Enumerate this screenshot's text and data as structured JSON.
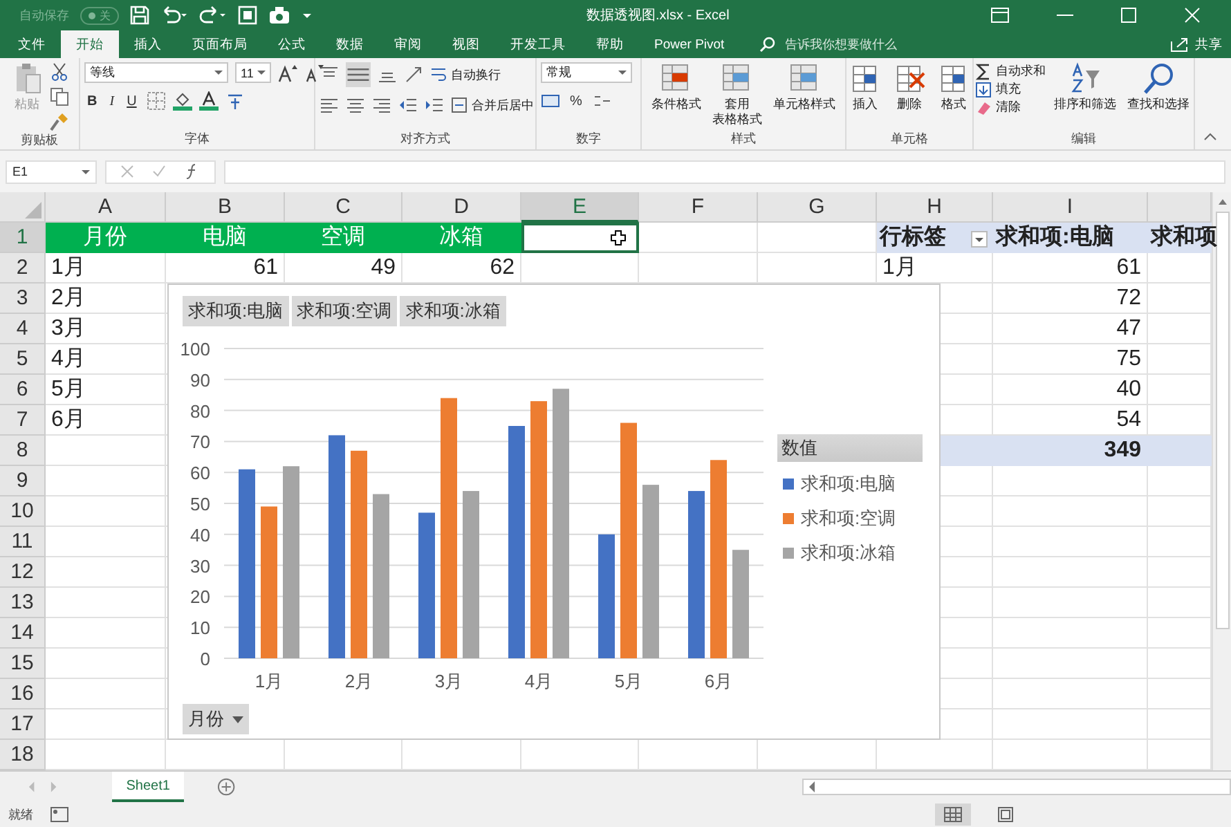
{
  "title_bar": {
    "autosave_label": "自动保存",
    "autosave_toggle": {
      "label": "关",
      "on": false
    },
    "title": "数据透视图.xlsx - Excel"
  },
  "tabs": [
    {
      "label": "文件",
      "selected": false
    },
    {
      "label": "开始",
      "selected": true
    },
    {
      "label": "插入",
      "selected": false
    },
    {
      "label": "页面布局",
      "selected": false
    },
    {
      "label": "公式",
      "selected": false
    },
    {
      "label": "数据",
      "selected": false
    },
    {
      "label": "审阅",
      "selected": false
    },
    {
      "label": "视图",
      "selected": false
    },
    {
      "label": "开发工具",
      "selected": false
    },
    {
      "label": "帮助",
      "selected": false
    },
    {
      "label": "Power Pivot",
      "selected": false
    }
  ],
  "tell_me": {
    "placeholder": "告诉我你想要做什么"
  },
  "share": "共享",
  "ribbon": {
    "clipboard": {
      "label": "剪贴板",
      "paste": "粘贴"
    },
    "font": {
      "label": "字体",
      "font_name": "等线",
      "font_size": "11",
      "bold": "B",
      "italic": "I",
      "underline": "U"
    },
    "alignment": {
      "label": "对齐方式",
      "wrap": "自动换行",
      "merge": "合并后居中"
    },
    "number": {
      "label": "数字",
      "format": "常规",
      "percent": "%"
    },
    "styles": {
      "label": "样式",
      "items": [
        {
          "lines": [
            "条件格式"
          ]
        },
        {
          "lines": [
            "套用",
            "表格格式"
          ]
        },
        {
          "lines": [
            "单元格样式"
          ]
        }
      ]
    },
    "cells": {
      "label": "单元格",
      "items": [
        {
          "label": "插入"
        },
        {
          "label": "删除"
        },
        {
          "label": "格式"
        }
      ]
    },
    "editing": {
      "label": "编辑",
      "autosum": "自动求和",
      "fill": "填充",
      "clear": "清除",
      "sort": "排序和筛选",
      "find": "查找和选择"
    }
  },
  "formula_bar": {
    "name_box": "E1"
  },
  "sheet": {
    "columns": [
      {
        "label": "A",
        "selected": false
      },
      {
        "label": "B",
        "selected": false
      },
      {
        "label": "C",
        "selected": false
      },
      {
        "label": "D",
        "selected": false
      },
      {
        "label": "E",
        "selected": true
      },
      {
        "label": "F",
        "selected": false
      },
      {
        "label": "G",
        "selected": false
      },
      {
        "label": "H",
        "selected": false
      },
      {
        "label": "I",
        "selected": false
      },
      {
        "selected": false
      }
    ],
    "rows": [
      {
        "number": "1",
        "selected": true,
        "cells": [
          {
            "kind": "header",
            "text": "月份"
          },
          {
            "kind": "header",
            "text": "电脑"
          },
          {
            "kind": "header",
            "text": "空调"
          },
          {
            "kind": "header",
            "text": "冰箱"
          },
          {
            "kind": "empty"
          },
          {
            "kind": "empty"
          },
          {
            "kind": "empty"
          },
          {
            "kind": "pivot_header",
            "text": "行标签",
            "filter": true
          },
          {
            "kind": "pivot_header",
            "text": "求和项:电脑"
          },
          {
            "kind": "pivot_header",
            "text": "求和项"
          }
        ]
      },
      {
        "number": "2",
        "selected": false,
        "cells": [
          {
            "kind": "text",
            "text": "1月"
          },
          {
            "kind": "number",
            "text": "61"
          },
          {
            "kind": "number",
            "text": "49"
          },
          {
            "kind": "number",
            "text": "62"
          },
          {
            "kind": "empty"
          },
          {
            "kind": "empty"
          },
          {
            "kind": "empty"
          },
          {
            "kind": "text",
            "text": "1月"
          },
          {
            "kind": "number",
            "text": "61"
          },
          {
            "kind": "empty"
          }
        ]
      },
      {
        "number": "3",
        "selected": false,
        "cells": [
          {
            "kind": "text",
            "text": "2月"
          },
          {
            "kind": "empty"
          },
          {
            "kind": "empty"
          },
          {
            "kind": "empty"
          },
          {
            "kind": "empty"
          },
          {
            "kind": "empty"
          },
          {
            "kind": "empty"
          },
          {
            "kind": "empty"
          },
          {
            "kind": "number",
            "text": "72"
          },
          {
            "kind": "empty"
          }
        ]
      },
      {
        "number": "4",
        "selected": false,
        "cells": [
          {
            "kind": "text",
            "text": "3月"
          },
          {
            "kind": "empty"
          },
          {
            "kind": "empty"
          },
          {
            "kind": "empty"
          },
          {
            "kind": "empty"
          },
          {
            "kind": "empty"
          },
          {
            "kind": "empty"
          },
          {
            "kind": "empty"
          },
          {
            "kind": "number",
            "text": "47"
          },
          {
            "kind": "empty"
          }
        ]
      },
      {
        "number": "5",
        "selected": false,
        "cells": [
          {
            "kind": "text",
            "text": "4月"
          },
          {
            "kind": "empty"
          },
          {
            "kind": "empty"
          },
          {
            "kind": "empty"
          },
          {
            "kind": "empty"
          },
          {
            "kind": "empty"
          },
          {
            "kind": "empty"
          },
          {
            "kind": "empty"
          },
          {
            "kind": "number",
            "text": "75"
          },
          {
            "kind": "empty"
          }
        ]
      },
      {
        "number": "6",
        "selected": false,
        "cells": [
          {
            "kind": "text",
            "text": "5月"
          },
          {
            "kind": "empty"
          },
          {
            "kind": "empty"
          },
          {
            "kind": "empty"
          },
          {
            "kind": "empty"
          },
          {
            "kind": "empty"
          },
          {
            "kind": "empty"
          },
          {
            "kind": "empty"
          },
          {
            "kind": "number",
            "text": "40"
          },
          {
            "kind": "empty"
          }
        ]
      },
      {
        "number": "7",
        "selected": false,
        "cells": [
          {
            "kind": "text",
            "text": "6月"
          },
          {
            "kind": "empty"
          },
          {
            "kind": "empty"
          },
          {
            "kind": "empty"
          },
          {
            "kind": "empty"
          },
          {
            "kind": "empty"
          },
          {
            "kind": "empty"
          },
          {
            "kind": "empty"
          },
          {
            "kind": "number",
            "text": "54"
          },
          {
            "kind": "empty"
          }
        ]
      },
      {
        "number": "8",
        "selected": false,
        "cells": [
          {
            "kind": "empty"
          },
          {
            "kind": "empty"
          },
          {
            "kind": "empty"
          },
          {
            "kind": "empty"
          },
          {
            "kind": "empty"
          },
          {
            "kind": "empty"
          },
          {
            "kind": "empty"
          },
          {
            "kind": "total_band"
          },
          {
            "kind": "total",
            "text": "349"
          },
          {
            "kind": "total_band"
          }
        ]
      },
      {
        "number": "9",
        "selected": false
      },
      {
        "number": "10",
        "selected": false
      },
      {
        "number": "11",
        "selected": false
      },
      {
        "number": "12",
        "selected": false
      },
      {
        "number": "13",
        "selected": false
      },
      {
        "number": "14",
        "selected": false
      },
      {
        "number": "15",
        "selected": false
      },
      {
        "number": "16",
        "selected": false
      },
      {
        "number": "17",
        "selected": false
      },
      {
        "number": "18",
        "selected": false
      }
    ]
  },
  "pivot_chart": {
    "value_buttons": [
      "求和项:电脑",
      "求和项:空调",
      "求和项:冰箱"
    ],
    "legend_title": "数值",
    "axis_button": "月份",
    "chart_data": {
      "type": "bar",
      "categories": [
        "1月",
        "2月",
        "3月",
        "4月",
        "5月",
        "6月"
      ],
      "series": [
        {
          "name": "求和项:电脑",
          "color": "#4472c4",
          "values": [
            61,
            72,
            47,
            75,
            40,
            54
          ]
        },
        {
          "name": "求和项:空调",
          "color": "#ed7d31",
          "values": [
            49,
            67,
            84,
            83,
            76,
            64
          ]
        },
        {
          "name": "求和项:冰箱",
          "color": "#a5a5a5",
          "values": [
            62,
            53,
            54,
            87,
            56,
            35
          ]
        }
      ],
      "grid": true,
      "ylim": [
        0,
        100
      ],
      "yticks": [
        0,
        10,
        20,
        30,
        40,
        50,
        60,
        70,
        80,
        90,
        100
      ]
    }
  },
  "sheet_tabs": [
    {
      "label": "Sheet1",
      "selected": true
    }
  ],
  "status_bar": {
    "text": "就绪"
  }
}
